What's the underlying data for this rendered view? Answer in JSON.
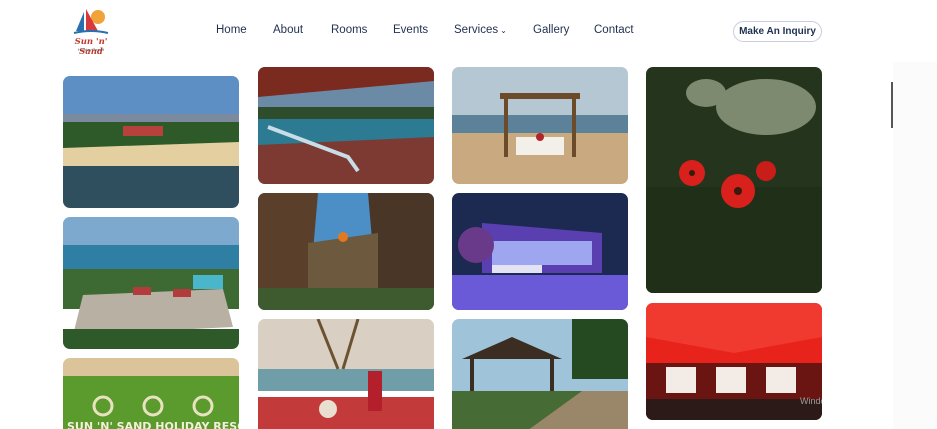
{
  "brand": {
    "name": "Sun 'n' Sand",
    "tagline": "Holiday Resort"
  },
  "nav": {
    "items": [
      {
        "label": "Home"
      },
      {
        "label": "About"
      },
      {
        "label": "Rooms"
      },
      {
        "label": "Events"
      },
      {
        "label": "Services"
      },
      {
        "label": "Gallery"
      },
      {
        "label": "Contact"
      }
    ],
    "inquiry_label": "Make An Inquiry"
  },
  "gallery": {
    "images": [
      {
        "subject": "beach-aerial"
      },
      {
        "subject": "pool-lounge-chair"
      },
      {
        "subject": "beach-cabana-dinner"
      },
      {
        "subject": "statue-red-flowers"
      },
      {
        "subject": "resort-aerial-pool"
      },
      {
        "subject": "rock-waterfall"
      },
      {
        "subject": "night-lit-patio"
      },
      {
        "subject": "aerial-garden-sign"
      },
      {
        "subject": "beach-table-setting"
      },
      {
        "subject": "garden-gazebo"
      },
      {
        "subject": "red-tent-dining"
      }
    ],
    "sign_text": "SUN 'N' SAND HOLIDAY RESORT"
  },
  "colors": {
    "nav_text": "#1f3050",
    "brand_red": "#c0392b",
    "accent_red": "#e8231c"
  },
  "watermark": "Windows"
}
